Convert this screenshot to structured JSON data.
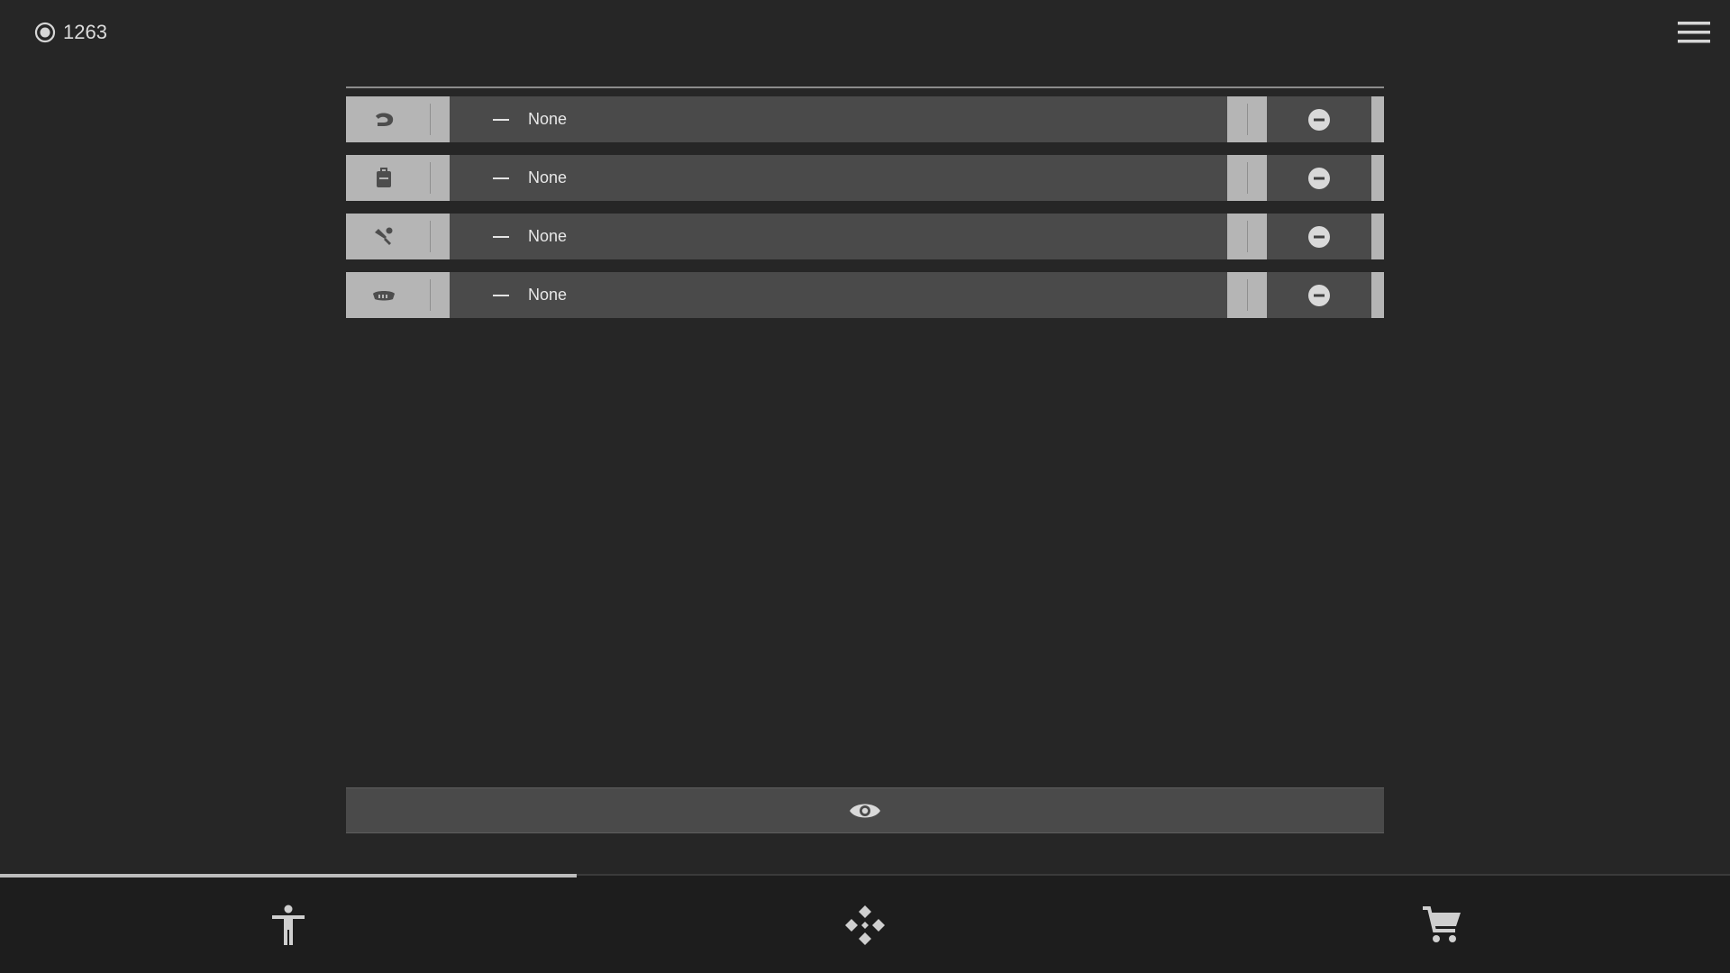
{
  "currency": {
    "icon": "coin-icon",
    "amount": "1263"
  },
  "menu": {
    "icon": "hamburger-menu-icon"
  },
  "slots": [
    {
      "icon": "helmet-icon",
      "value": "None"
    },
    {
      "icon": "backpack-icon",
      "value": "None"
    },
    {
      "icon": "tool-icon",
      "value": "None"
    },
    {
      "icon": "mask-icon",
      "value": "None"
    }
  ],
  "preview": {
    "icon": "eye-icon"
  },
  "bottom_nav": {
    "active_tab": "character",
    "tabs": [
      {
        "id": "character",
        "icon": "person-icon"
      },
      {
        "id": "items",
        "icon": "diamond-cluster-icon"
      },
      {
        "id": "shop",
        "icon": "shopping-cart-icon"
      }
    ]
  },
  "colors": {
    "background": "#262626",
    "row": "#4a4a4a",
    "cell_light": "#b5b5b5",
    "nav_background": "#1d1d1d",
    "text": "#e8e8e8"
  }
}
